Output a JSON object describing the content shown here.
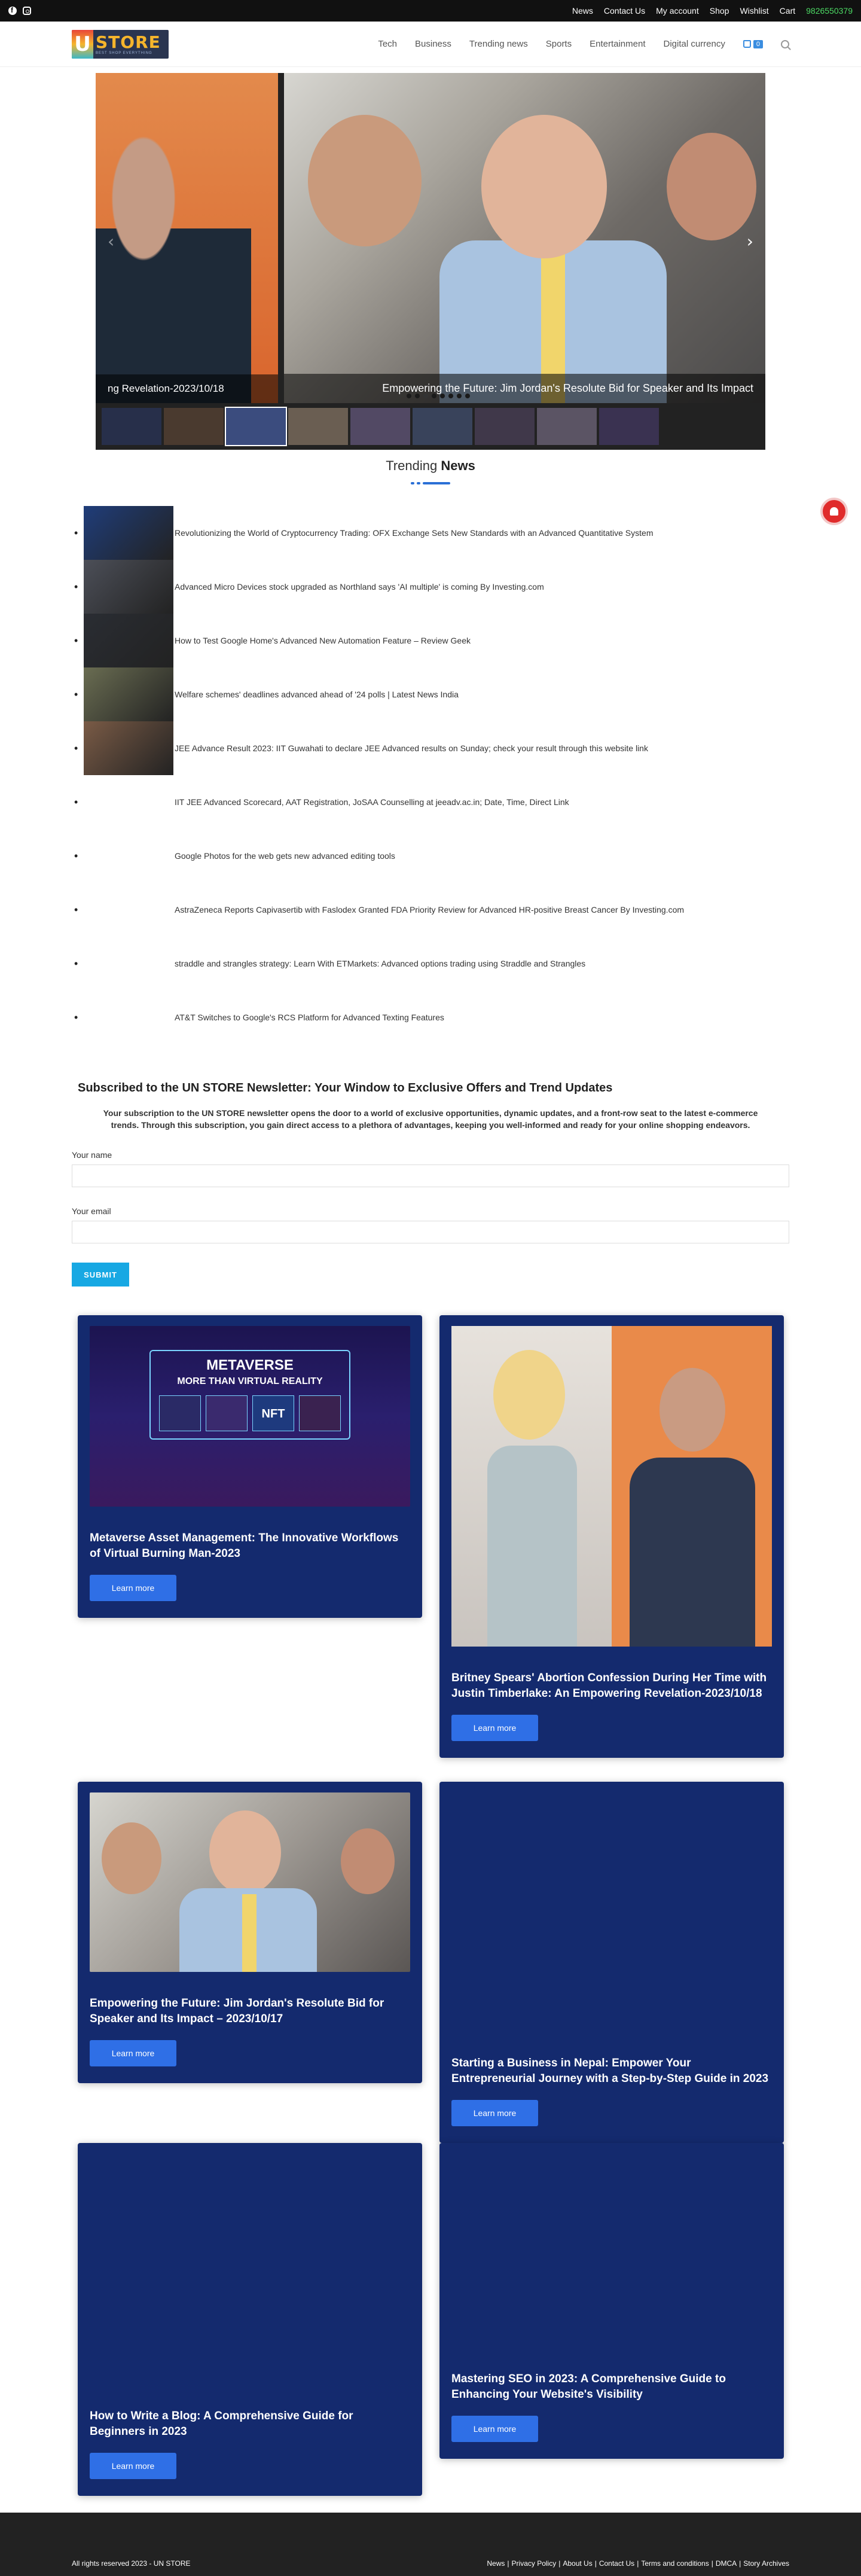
{
  "topbar": {
    "social": [
      "facebook-icon",
      "instagram-icon"
    ],
    "links": [
      "News",
      "Contact Us",
      "My account",
      "Shop",
      "Wishlist",
      "Cart"
    ],
    "phone": "9826550379"
  },
  "header": {
    "logo_big": "STORE",
    "logo_letter": "U",
    "logo_small": "BEST SHOP EVERYTHING",
    "nav": [
      "Tech",
      "Business",
      "Trending news",
      "Sports",
      "Entertainment",
      "Digital currency"
    ],
    "cart_count": "0"
  },
  "slider": {
    "left_caption": "ng Revelation-2023/10/18",
    "main_caption": "Empowering the Future: Jim Jordan's Resolute Bid for Speaker and Its Impact",
    "thumb_colors": [
      "#2c3a6b",
      "#6b4e3a",
      "#3b4c7e",
      "#a58f7a",
      "#7a6a9a",
      "#4c5e8b",
      "#5a4a6b",
      "#8a7d9b",
      "#4e3f78"
    ]
  },
  "trending": {
    "title_plain": "Trending",
    "title_bold": "News",
    "items": [
      {
        "text": "Revolutionizing the World of Cryptocurrency Trading: OFX Exchange Sets New Standards with an Advanced Quantitative System",
        "color": "#1f3d7a"
      },
      {
        "text": "Advanced Micro Devices stock upgraded as Northland says 'AI multiple' is coming By Investing.com",
        "color": "#4c4f58"
      },
      {
        "text": "How to Test Google Home's Advanced New Automation Feature – Review Geek",
        "color": "#2a2d33"
      },
      {
        "text": "Welfare schemes' deadlines advanced ahead of '24 polls | Latest News India",
        "color": "#6a6d52"
      },
      {
        "text": "JEE Advance Result 2023: IIT Guwahati to declare JEE Advanced results on Sunday; check your result through this website link",
        "color": "#7a5b46"
      },
      {
        "text": "IIT JEE Advanced Scorecard, AAT Registration, JoSAA Counselling at jeeadv.ac.in; Date, Time, Direct Link",
        "color": ""
      },
      {
        "text": "Google Photos for the web gets new advanced editing tools",
        "color": ""
      },
      {
        "text": "AstraZeneca Reports Capivasertib with Faslodex Granted FDA Priority Review for Advanced HR-positive Breast Cancer By Investing.com",
        "color": ""
      },
      {
        "text": "straddle and strangles strategy: Learn With ETMarkets: Advanced options trading using Straddle and Strangles",
        "color": ""
      },
      {
        "text": "AT&T Switches to Google's RCS Platform for Advanced Texting Features",
        "color": ""
      }
    ]
  },
  "newsletter": {
    "title": "Subscribed to the UN STORE Newsletter: Your Window to Exclusive Offers and Trend Updates",
    "description": "Your subscription to the UN STORE newsletter opens the door to a world of exclusive opportunities, dynamic updates, and a front-row seat to the latest e-commerce trends. Through this subscription, you gain direct access to a plethora of advantages, keeping you well-informed and ready for your online shopping endeavors.",
    "name_label": "Your name",
    "email_label": "Your email",
    "submit_label": "SUBMIT"
  },
  "cards": [
    {
      "title": "Metaverse Asset Management: The Innovative Workflows of Virtual Burning Man-2023",
      "button": "Learn more",
      "image_line1": "METAVERSE",
      "image_line2": "MORE THAN VIRTUAL REALITY",
      "image_badge": "NFT"
    },
    {
      "title": "Britney Spears' Abortion Confession During Her Time with Justin Timberlake: An Empowering Revelation-2023/10/18",
      "button": "Learn more"
    },
    {
      "title": "Empowering the Future: Jim Jordan's Resolute Bid for Speaker and Its Impact – 2023/10/17",
      "button": "Learn more"
    },
    {
      "title": "Starting a Business in Nepal: Empower Your Entrepreneurial Journey with a Step-by-Step Guide in 2023",
      "button": "Learn more"
    },
    {
      "title": "How to Write a Blog: A Comprehensive Guide for Beginners in 2023",
      "button": "Learn more"
    },
    {
      "title": "Mastering SEO in 2023: A Comprehensive Guide to Enhancing Your Website's Visibility",
      "button": "Learn more"
    }
  ],
  "footer": {
    "copyright": "All rights reserved 2023 - UN STORE",
    "links": [
      "News",
      "Privacy Policy",
      "About Us",
      "Contact Us",
      "Terms and conditions",
      "DMCA",
      "Story Archives"
    ]
  }
}
